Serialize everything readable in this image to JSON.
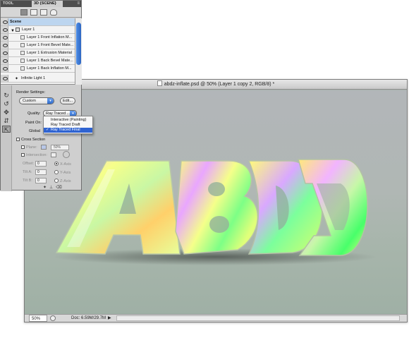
{
  "panel": {
    "tabs": [
      {
        "label": "TOOL PRESETS"
      },
      {
        "label": "3D {SCENE}"
      }
    ],
    "menu_icon": "panel-menu-icon",
    "filter_buttons": [
      "scene-filter-icon",
      "mesh-filter-icon",
      "material-filter-icon",
      "light-filter-icon"
    ],
    "scene_list": {
      "rows": [
        {
          "label": "Scene"
        },
        {
          "label": "Layer 1"
        },
        {
          "label": "Layer 1 Front Inflation M..."
        },
        {
          "label": "Layer 1 Front Bevel Mate..."
        },
        {
          "label": "Layer 1 Extrusion Material"
        },
        {
          "label": "Layer 1 Back Bevel Mate..."
        },
        {
          "label": "Layer 1 Back Inflation M..."
        },
        {
          "label": "Infinite Light 1"
        }
      ]
    },
    "render_settings": {
      "label": "Render Settings:",
      "preset": "Custom",
      "edit_button": "Edit...",
      "quality_label": "Quality:",
      "quality_value": "Ray Traced ...",
      "paint_on_label": "Paint On:",
      "global_label": "Global",
      "quality_options": [
        {
          "label": "Interactive (Painting)"
        },
        {
          "label": "Ray Traced Draft"
        },
        {
          "label": "Ray Traced Final",
          "selected": true
        }
      ]
    },
    "cross_section": {
      "label": "Cross Section",
      "plane_label": "Plane:",
      "plane_opacity": "50%",
      "intersection_label": "Intersection:",
      "offset_label": "Offset:",
      "offset_value": "0",
      "tilt_a_label": "Tilt A:",
      "tilt_a_value": "0",
      "tilt_b_label": "Tilt B:",
      "tilt_b_value": "0",
      "axes": [
        "X-Axis",
        "Y-Axis",
        "Z-Axis"
      ],
      "selected_axis": "X-Axis"
    }
  },
  "document": {
    "title": "abdz-inflate.psd @ 50% (Layer 1 copy 2, RGB/8) *",
    "canvas_text": "ABDZ",
    "status": {
      "zoom": "50%",
      "doc_size": "Doc: 6.59M/29.7M"
    },
    "colors": {
      "canvas_bg": "#a9b3ad",
      "selection": "#2f63d1"
    }
  }
}
